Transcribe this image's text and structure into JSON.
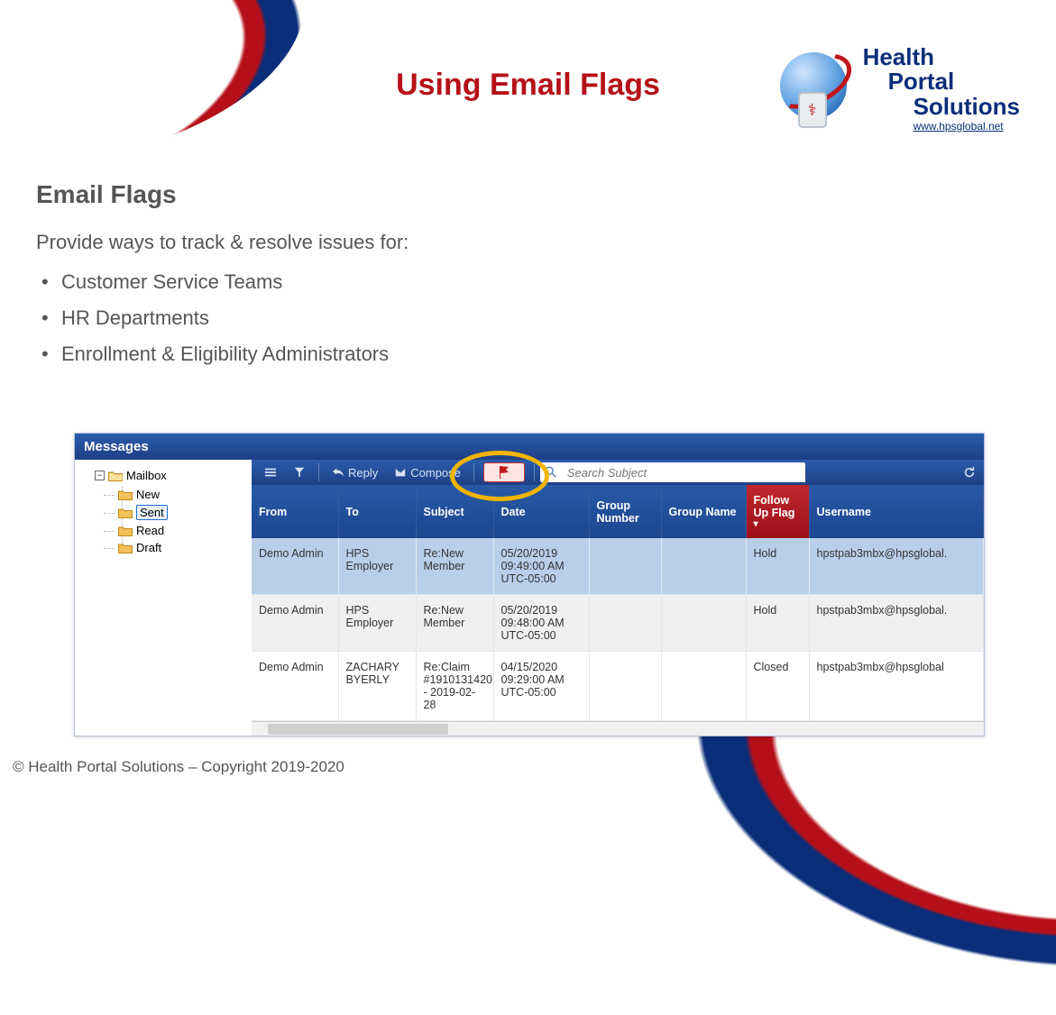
{
  "slide": {
    "title": "Using Email Flags",
    "section_heading": "Email Flags",
    "intro": "Provide ways to track & resolve issues for:",
    "bullets": [
      "Customer Service Teams",
      "HR Departments",
      "Enrollment & Eligibility Administrators"
    ],
    "copyright": "© Health Portal Solutions – Copyright 2019-2020"
  },
  "logo": {
    "line1": "Health",
    "line2": "Portal",
    "line3": "Solutions",
    "url": "www.hpsglobal.net"
  },
  "messages": {
    "panel_title": "Messages",
    "tree": {
      "root": "Mailbox",
      "children": [
        "New",
        "Sent",
        "Read",
        "Draft"
      ],
      "selected": "Sent"
    },
    "toolbar": {
      "reply": "Reply",
      "compose": "Compose",
      "search_placeholder": "Search Subject"
    },
    "columns": [
      "From",
      "To",
      "Subject",
      "Date",
      "Group Number",
      "Group Name",
      "Follow Up Flag",
      "Username"
    ],
    "sort_column": "Follow Up Flag",
    "rows": [
      {
        "from": "Demo Admin",
        "to": "HPS Employer",
        "subject": "Re:New Member",
        "date": "05/20/2019 09:49:00 AM UTC-05:00",
        "group_number": "",
        "group_name": "",
        "flag": "Hold",
        "username": "hpstpab3mbx@hpsglobal."
      },
      {
        "from": "Demo Admin",
        "to": "HPS Employer",
        "subject": "Re:New Member",
        "date": "05/20/2019 09:48:00 AM UTC-05:00",
        "group_number": "",
        "group_name": "",
        "flag": "Hold",
        "username": "hpstpab3mbx@hpsglobal."
      },
      {
        "from": "Demo Admin",
        "to": "ZACHARY BYERLY",
        "subject": "Re:Claim #1910131420 - 2019-02-28",
        "date": "04/15/2020 09:29:00 AM UTC-05:00",
        "group_number": "",
        "group_name": "",
        "flag": "Closed",
        "username": "hpstpab3mbx@hpsglobal"
      }
    ]
  }
}
